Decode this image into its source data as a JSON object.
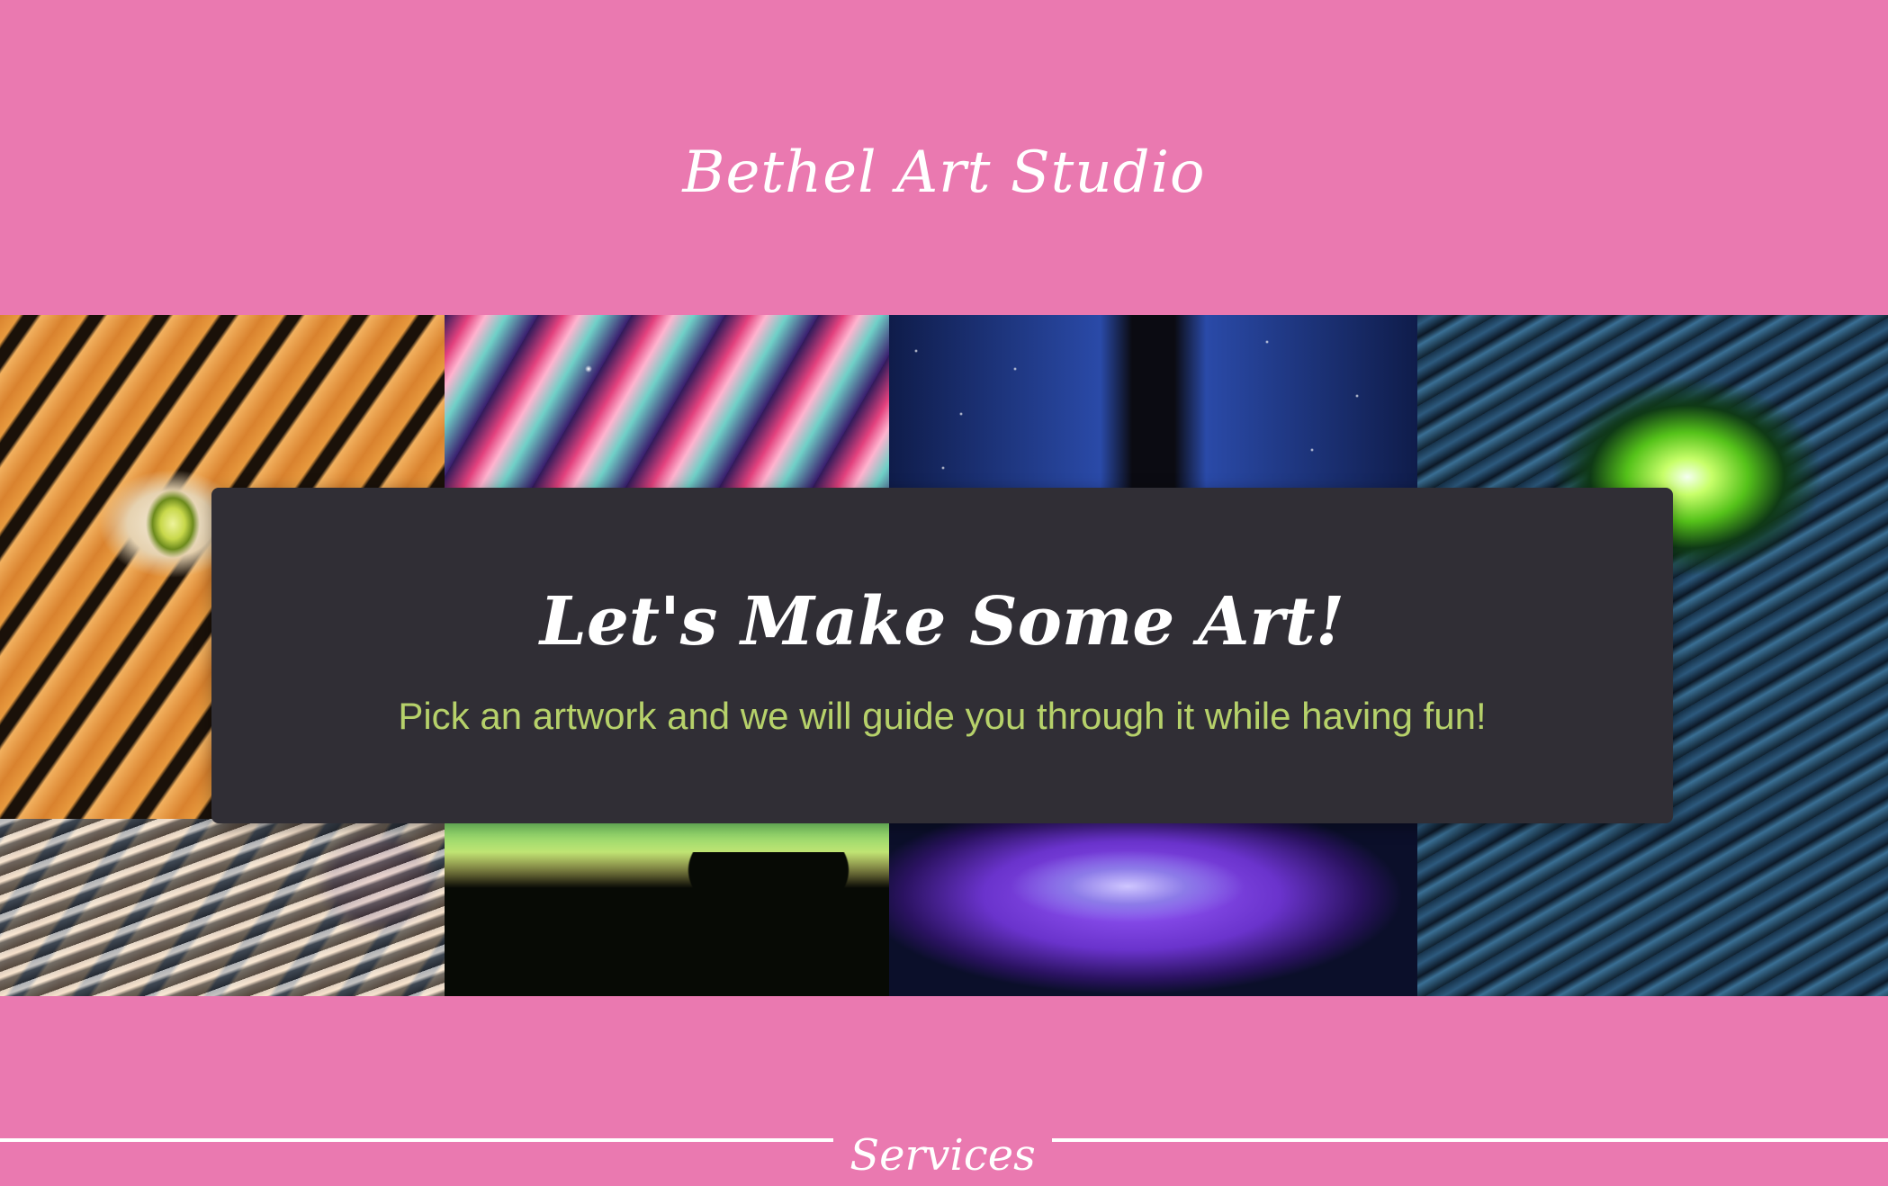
{
  "header": {
    "title": "Bethel Art Studio"
  },
  "hero": {
    "heading": "Let's Make Some Art!",
    "subtitle": "Pick an artwork and we will guide you through it while having fun!"
  },
  "services": {
    "heading": "Services"
  },
  "colors": {
    "page_background": "#ea79b0",
    "card_background": "#302e35",
    "subtitle_text": "#b6d16a",
    "title_text": "#ffffff"
  }
}
